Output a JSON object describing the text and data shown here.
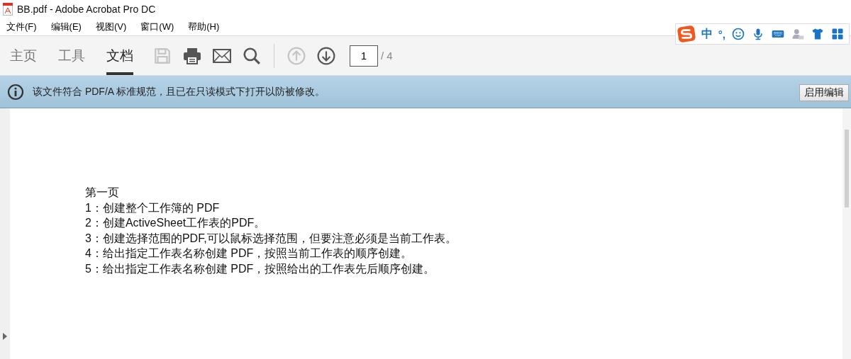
{
  "window": {
    "title": "BB.pdf - Adobe Acrobat Pro DC"
  },
  "menu": [
    "文件(F)",
    "编辑(E)",
    "视图(V)",
    "窗口(W)",
    "帮助(H)"
  ],
  "tabs": [
    {
      "label": "主页",
      "selected": false
    },
    {
      "label": "工具",
      "selected": false
    },
    {
      "label": "文档",
      "selected": true
    }
  ],
  "tools": [
    {
      "kind": "save",
      "disabled": true
    },
    {
      "kind": "print",
      "disabled": false
    },
    {
      "kind": "mail",
      "disabled": false
    },
    {
      "kind": "search",
      "disabled": false
    },
    {
      "kind": "up",
      "disabled": true
    },
    {
      "kind": "down",
      "disabled": false
    }
  ],
  "page": {
    "value": "1",
    "total": "/ 4"
  },
  "ime": {
    "mode": "中",
    "punct": "°,"
  },
  "info_bar": {
    "message": "该文件符合 PDF/A 标准规范，且已在只读模式下打开以防被修改。",
    "button": "启用编辑"
  },
  "document": {
    "lines": [
      "第一页",
      "1：创建整个工作簿的 PDF",
      "2：创建ActiveSheet工作表的PDF。",
      "3：创建选择范围的PDF,可以鼠标选择范围，但要注意必须是当前工作表。",
      "4：给出指定工作表名称创建 PDF，按照当前工作表的顺序创建。",
      "5：给出指定工作表名称创建 PDF，按照给出的工作表先后顺序创建。"
    ]
  }
}
